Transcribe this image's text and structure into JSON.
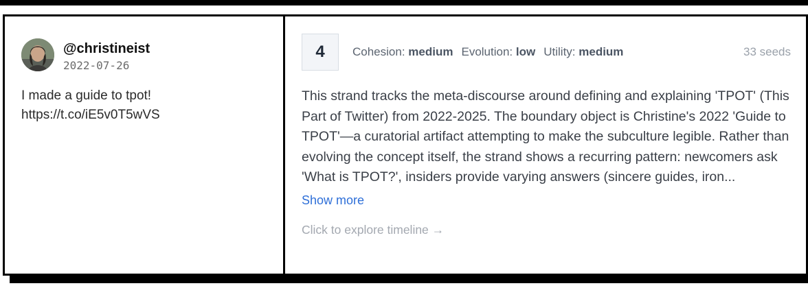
{
  "tweet": {
    "handle": "@christineist",
    "date": "2022-07-26",
    "text": "I made a guide to tpot!\nhttps://t.co/iE5v0T5wVS"
  },
  "strand": {
    "rank": "4",
    "metrics": [
      {
        "label": "Cohesion:",
        "value": "medium"
      },
      {
        "label": "Evolution:",
        "value": "low"
      },
      {
        "label": "Utility:",
        "value": "medium"
      }
    ],
    "seeds": "33 seeds",
    "summary": "This strand tracks the meta-discourse around defining and explaining 'TPOT' (This Part of Twitter) from 2022-2025. The boundary object is Christine's 2022 'Guide to TPOT'—a curatorial artifact attempting to make the subculture legible. Rather than evolving the concept itself, the strand shows a recurring pattern: newcomers ask 'What is TPOT?', insiders provide varying answers (sincere guides, iron...",
    "show_more": "Show more",
    "explore": "Click to explore timeline →"
  },
  "colors": {
    "border": "#000000",
    "link": "#2e6fd8",
    "muted": "#a3a8b0"
  }
}
